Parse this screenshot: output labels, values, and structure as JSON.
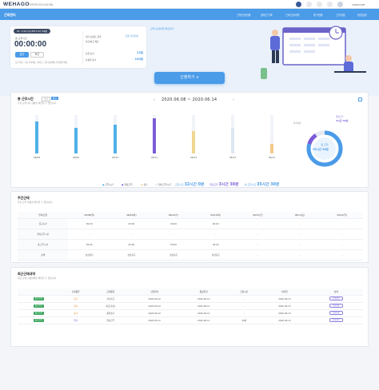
{
  "topbar": {
    "logo": "WEHAGO",
    "org": "THEPROSOLAB.ENL",
    "user": "SUNNY.KIM"
  },
  "nav": {
    "title": "근태관리",
    "items": [
      "근태신청현황",
      "출퇴근기록",
      "근태신청내역",
      "휴가현황",
      "근무일정",
      "환경설정"
    ]
  },
  "hero": {
    "date": "21. 4.21 (2) PM 12시 59분",
    "work_label": "총 근무시간",
    "clock": "00:00:00",
    "clock_in": "출근",
    "clock_out": "퇴근",
    "note": "출근/퇴근 시간 이후에는 출퇴근 근태 신청에서 변경해주세요.",
    "row1": "내가 쓰셨던 근태",
    "row2": "출근/퇴근 체크",
    "row3": "남은 휴가",
    "row4": "사용한 휴가",
    "v3": "12일",
    "v4": "100일",
    "link": "근태 신청내역 확인하기",
    "team": "팀원 근태현황"
  },
  "apply": "신청하기 ∨",
  "stats": {
    "title": "총 근무시간",
    "tag1": "주간",
    "tag2": "월간",
    "sub": "주간 근무시간 현황을 확인할 수 있습니다.",
    "range": "2020.06.08 ~ 2020.06.14",
    "donut_label": "총 근무",
    "donut_value": "35시간 30분",
    "donut_top1": "연장근무",
    "donut_top2": "3시간 30분",
    "donut_left": "연차사용"
  },
  "chart_data": {
    "type": "bar",
    "categories": [
      "06/08",
      "06/09",
      "06/10",
      "06/11",
      "06/12",
      "06/13",
      "06/14"
    ],
    "values": [
      10,
      8,
      9,
      11,
      7,
      8,
      3
    ],
    "ylim": [
      0,
      12
    ],
    "colors": [
      "#4fb1e8",
      "#4fb1e8",
      "#4fb1e8",
      "#7c5cd8",
      "#f0d690",
      "#dce7f2",
      "#f5c98a"
    ]
  },
  "legend": [
    "근무시간",
    "연장근무",
    "휴가",
    "현재 근무시간"
  ],
  "summary": {
    "a_label": "근무시간",
    "a_val": "32시간 0분",
    "b_label": "연장근무",
    "b_val": "3시간 30분",
    "c_label": "총 근무시간",
    "c_val": "35시간 30분"
  },
  "weekly": {
    "title": "주간근태",
    "sub": "주간 근무 일정을 확인할 수 있습니다.",
    "headers": [
      "일자/요일",
      "06/08(월)",
      "06/09(화)",
      "06/10(수)",
      "06/11(목)",
      "06/12(금)",
      "06/13(토)",
      "06/14(일)"
    ],
    "rows": [
      [
        "출근시간",
        "09:00",
        "09:00",
        "09:00",
        "09:00",
        "-",
        "-",
        "-"
      ],
      [
        "연장근무시간",
        "-",
        "-",
        "-",
        "-",
        "-",
        "-",
        "-"
      ],
      [
        "총 근무시간",
        "09:00",
        "09:00",
        "09:00",
        "09:00",
        "-",
        "-",
        "-"
      ],
      [
        "상태",
        "정상출근",
        "정상출근",
        "정상출근",
        "정상출근",
        "-",
        "-",
        "-"
      ]
    ]
  },
  "history": {
    "title": "최근근태내역",
    "sub": "최근 근태 신청내역을 확인할 수 있습니다.",
    "headers": [
      "",
      "신청종류",
      "근태종류",
      "신청일자",
      "종료일자",
      "신청시간",
      "처리일",
      "상태"
    ],
    "rows": [
      [
        "출근승인",
        "출근",
        "지각출근",
        "2020.06.12",
        "2020.06.12",
        "-",
        "2020.06.13",
        "승인완료"
      ],
      [
        "출근승인",
        "출장",
        "외근(출장)",
        "2020.06.12",
        "2020.06.12",
        "-",
        "2020.06.13",
        "승인완료"
      ],
      [
        "출근승인",
        "휴가",
        "종일휴가",
        "2020.06.12",
        "2020.06.12",
        "-",
        "2020.06.13",
        "승인완료"
      ],
      [
        "출근승인",
        "연장",
        "연장근무",
        "2020.06.11",
        "2020.06.11",
        "30분",
        "2020.06.13",
        "승인완료"
      ]
    ]
  }
}
